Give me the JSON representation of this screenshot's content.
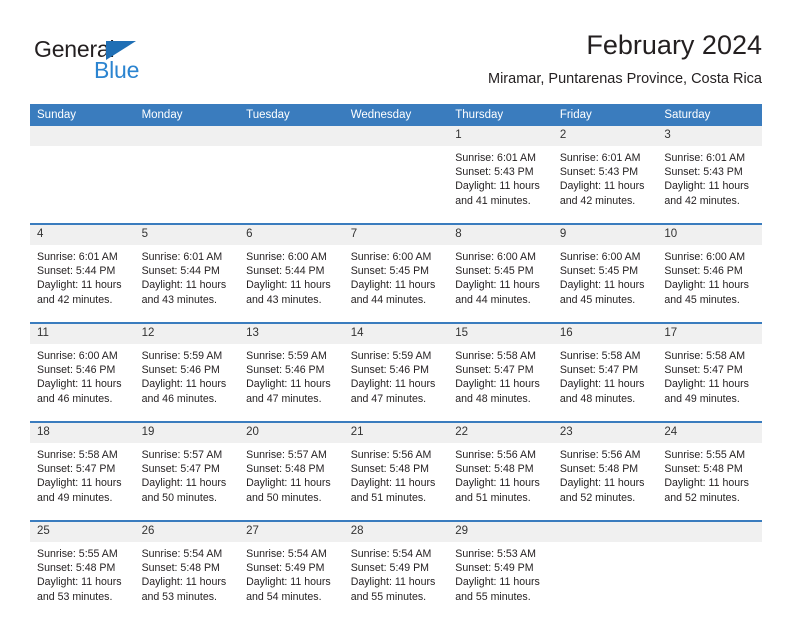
{
  "brand": {
    "name_part1": "General",
    "name_part2": "Blue",
    "icon": "triangle-logo-icon",
    "color_dark": "#231f20",
    "color_blue": "#2b84d0",
    "color_triangle": "#1f6fb5"
  },
  "header": {
    "title": "February 2024",
    "location": "Miramar, Puntarenas Province, Costa Rica"
  },
  "theme": {
    "header_row_bg": "#3a7cbe",
    "daynum_bg": "#f0f0f0",
    "text": "#231f20"
  },
  "calendar": {
    "weekday_headers": [
      "Sunday",
      "Monday",
      "Tuesday",
      "Wednesday",
      "Thursday",
      "Friday",
      "Saturday"
    ],
    "weeks": [
      [
        {
          "day": "",
          "empty": true,
          "sunrise": "",
          "sunset": "",
          "daylight_line1": "",
          "daylight_line2": ""
        },
        {
          "day": "",
          "empty": true,
          "sunrise": "",
          "sunset": "",
          "daylight_line1": "",
          "daylight_line2": ""
        },
        {
          "day": "",
          "empty": true,
          "sunrise": "",
          "sunset": "",
          "daylight_line1": "",
          "daylight_line2": ""
        },
        {
          "day": "",
          "empty": true,
          "sunrise": "",
          "sunset": "",
          "daylight_line1": "",
          "daylight_line2": ""
        },
        {
          "day": "1",
          "empty": false,
          "sunrise": "Sunrise: 6:01 AM",
          "sunset": "Sunset: 5:43 PM",
          "daylight_line1": "Daylight: 11 hours",
          "daylight_line2": "and 41 minutes."
        },
        {
          "day": "2",
          "empty": false,
          "sunrise": "Sunrise: 6:01 AM",
          "sunset": "Sunset: 5:43 PM",
          "daylight_line1": "Daylight: 11 hours",
          "daylight_line2": "and 42 minutes."
        },
        {
          "day": "3",
          "empty": false,
          "sunrise": "Sunrise: 6:01 AM",
          "sunset": "Sunset: 5:43 PM",
          "daylight_line1": "Daylight: 11 hours",
          "daylight_line2": "and 42 minutes."
        }
      ],
      [
        {
          "day": "4",
          "empty": false,
          "sunrise": "Sunrise: 6:01 AM",
          "sunset": "Sunset: 5:44 PM",
          "daylight_line1": "Daylight: 11 hours",
          "daylight_line2": "and 42 minutes."
        },
        {
          "day": "5",
          "empty": false,
          "sunrise": "Sunrise: 6:01 AM",
          "sunset": "Sunset: 5:44 PM",
          "daylight_line1": "Daylight: 11 hours",
          "daylight_line2": "and 43 minutes."
        },
        {
          "day": "6",
          "empty": false,
          "sunrise": "Sunrise: 6:00 AM",
          "sunset": "Sunset: 5:44 PM",
          "daylight_line1": "Daylight: 11 hours",
          "daylight_line2": "and 43 minutes."
        },
        {
          "day": "7",
          "empty": false,
          "sunrise": "Sunrise: 6:00 AM",
          "sunset": "Sunset: 5:45 PM",
          "daylight_line1": "Daylight: 11 hours",
          "daylight_line2": "and 44 minutes."
        },
        {
          "day": "8",
          "empty": false,
          "sunrise": "Sunrise: 6:00 AM",
          "sunset": "Sunset: 5:45 PM",
          "daylight_line1": "Daylight: 11 hours",
          "daylight_line2": "and 44 minutes."
        },
        {
          "day": "9",
          "empty": false,
          "sunrise": "Sunrise: 6:00 AM",
          "sunset": "Sunset: 5:45 PM",
          "daylight_line1": "Daylight: 11 hours",
          "daylight_line2": "and 45 minutes."
        },
        {
          "day": "10",
          "empty": false,
          "sunrise": "Sunrise: 6:00 AM",
          "sunset": "Sunset: 5:46 PM",
          "daylight_line1": "Daylight: 11 hours",
          "daylight_line2": "and 45 minutes."
        }
      ],
      [
        {
          "day": "11",
          "empty": false,
          "sunrise": "Sunrise: 6:00 AM",
          "sunset": "Sunset: 5:46 PM",
          "daylight_line1": "Daylight: 11 hours",
          "daylight_line2": "and 46 minutes."
        },
        {
          "day": "12",
          "empty": false,
          "sunrise": "Sunrise: 5:59 AM",
          "sunset": "Sunset: 5:46 PM",
          "daylight_line1": "Daylight: 11 hours",
          "daylight_line2": "and 46 minutes."
        },
        {
          "day": "13",
          "empty": false,
          "sunrise": "Sunrise: 5:59 AM",
          "sunset": "Sunset: 5:46 PM",
          "daylight_line1": "Daylight: 11 hours",
          "daylight_line2": "and 47 minutes."
        },
        {
          "day": "14",
          "empty": false,
          "sunrise": "Sunrise: 5:59 AM",
          "sunset": "Sunset: 5:46 PM",
          "daylight_line1": "Daylight: 11 hours",
          "daylight_line2": "and 47 minutes."
        },
        {
          "day": "15",
          "empty": false,
          "sunrise": "Sunrise: 5:58 AM",
          "sunset": "Sunset: 5:47 PM",
          "daylight_line1": "Daylight: 11 hours",
          "daylight_line2": "and 48 minutes."
        },
        {
          "day": "16",
          "empty": false,
          "sunrise": "Sunrise: 5:58 AM",
          "sunset": "Sunset: 5:47 PM",
          "daylight_line1": "Daylight: 11 hours",
          "daylight_line2": "and 48 minutes."
        },
        {
          "day": "17",
          "empty": false,
          "sunrise": "Sunrise: 5:58 AM",
          "sunset": "Sunset: 5:47 PM",
          "daylight_line1": "Daylight: 11 hours",
          "daylight_line2": "and 49 minutes."
        }
      ],
      [
        {
          "day": "18",
          "empty": false,
          "sunrise": "Sunrise: 5:58 AM",
          "sunset": "Sunset: 5:47 PM",
          "daylight_line1": "Daylight: 11 hours",
          "daylight_line2": "and 49 minutes."
        },
        {
          "day": "19",
          "empty": false,
          "sunrise": "Sunrise: 5:57 AM",
          "sunset": "Sunset: 5:47 PM",
          "daylight_line1": "Daylight: 11 hours",
          "daylight_line2": "and 50 minutes."
        },
        {
          "day": "20",
          "empty": false,
          "sunrise": "Sunrise: 5:57 AM",
          "sunset": "Sunset: 5:48 PM",
          "daylight_line1": "Daylight: 11 hours",
          "daylight_line2": "and 50 minutes."
        },
        {
          "day": "21",
          "empty": false,
          "sunrise": "Sunrise: 5:56 AM",
          "sunset": "Sunset: 5:48 PM",
          "daylight_line1": "Daylight: 11 hours",
          "daylight_line2": "and 51 minutes."
        },
        {
          "day": "22",
          "empty": false,
          "sunrise": "Sunrise: 5:56 AM",
          "sunset": "Sunset: 5:48 PM",
          "daylight_line1": "Daylight: 11 hours",
          "daylight_line2": "and 51 minutes."
        },
        {
          "day": "23",
          "empty": false,
          "sunrise": "Sunrise: 5:56 AM",
          "sunset": "Sunset: 5:48 PM",
          "daylight_line1": "Daylight: 11 hours",
          "daylight_line2": "and 52 minutes."
        },
        {
          "day": "24",
          "empty": false,
          "sunrise": "Sunrise: 5:55 AM",
          "sunset": "Sunset: 5:48 PM",
          "daylight_line1": "Daylight: 11 hours",
          "daylight_line2": "and 52 minutes."
        }
      ],
      [
        {
          "day": "25",
          "empty": false,
          "sunrise": "Sunrise: 5:55 AM",
          "sunset": "Sunset: 5:48 PM",
          "daylight_line1": "Daylight: 11 hours",
          "daylight_line2": "and 53 minutes."
        },
        {
          "day": "26",
          "empty": false,
          "sunrise": "Sunrise: 5:54 AM",
          "sunset": "Sunset: 5:48 PM",
          "daylight_line1": "Daylight: 11 hours",
          "daylight_line2": "and 53 minutes."
        },
        {
          "day": "27",
          "empty": false,
          "sunrise": "Sunrise: 5:54 AM",
          "sunset": "Sunset: 5:49 PM",
          "daylight_line1": "Daylight: 11 hours",
          "daylight_line2": "and 54 minutes."
        },
        {
          "day": "28",
          "empty": false,
          "sunrise": "Sunrise: 5:54 AM",
          "sunset": "Sunset: 5:49 PM",
          "daylight_line1": "Daylight: 11 hours",
          "daylight_line2": "and 55 minutes."
        },
        {
          "day": "29",
          "empty": false,
          "sunrise": "Sunrise: 5:53 AM",
          "sunset": "Sunset: 5:49 PM",
          "daylight_line1": "Daylight: 11 hours",
          "daylight_line2": "and 55 minutes."
        },
        {
          "day": "",
          "empty": true,
          "sunrise": "",
          "sunset": "",
          "daylight_line1": "",
          "daylight_line2": ""
        },
        {
          "day": "",
          "empty": true,
          "sunrise": "",
          "sunset": "",
          "daylight_line1": "",
          "daylight_line2": ""
        }
      ]
    ]
  }
}
